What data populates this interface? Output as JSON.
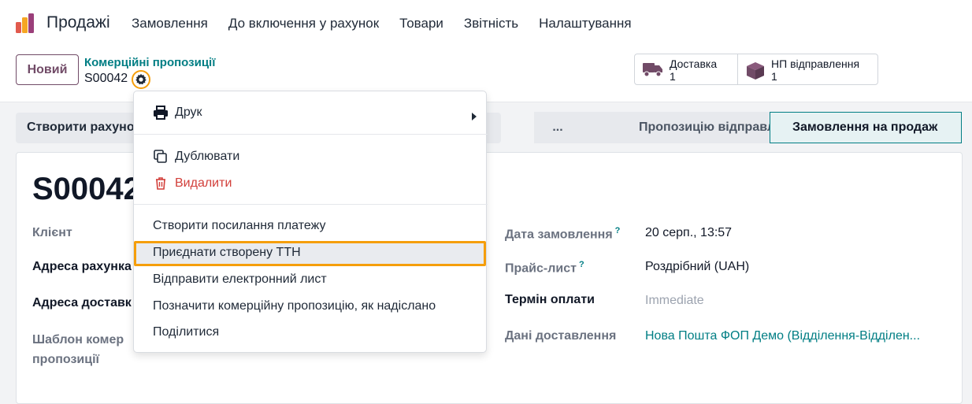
{
  "navbar": {
    "app_name": "Продажі",
    "menu": [
      "Замовлення",
      "До включення у рахунок",
      "Товари",
      "Звітність",
      "Налаштування"
    ]
  },
  "control": {
    "new_button": "Новий",
    "breadcrumb_parent": "Комерційні пропозиції",
    "breadcrumb_current": "S00042",
    "smart_buttons": [
      {
        "label": "Доставка",
        "count": "1",
        "icon": "truck-icon"
      },
      {
        "label": "НП відправлення",
        "count": "1",
        "icon": "box-icon"
      }
    ]
  },
  "actions": {
    "create_invoice": "Створити рахуно"
  },
  "statusbar": {
    "ellipsis": "...",
    "sent": "Пропозицію відправлено",
    "sale_order": "Замовлення на продаж"
  },
  "form": {
    "name": "S00042",
    "left_fields": {
      "client": "Клієнт",
      "invoice_address": "Адреса рахунка",
      "delivery_address": "Адреса доставк",
      "template_line1": "Шаблон комер",
      "template_line2": "пропозиції"
    },
    "right_fields": {
      "order_date_label": "Дата замовлення",
      "order_date_value": "20 серп., 13:57",
      "pricelist_label": "Прайс-лист",
      "pricelist_value": "Роздрібний (UAH)",
      "payment_terms_label": "Термін оплати",
      "payment_terms_value": "Immediate",
      "delivery_data_label": "Дані доставлення",
      "delivery_data_value": "Нова Пошта ФОП Демо (Відділення-Відділен..."
    },
    "help_mark": "?"
  },
  "dropdown": {
    "print": "Друк",
    "duplicate": "Дублювати",
    "delete": "Видалити",
    "payment_link": "Створити посилання платежу",
    "attach_ttn": "Приєднати створену ТТН",
    "send_email": "Відправити електронний лист",
    "mark_sent": "Позначити комерційну пропозицію, як надіслано",
    "share": "Поділитися"
  },
  "colors": {
    "brand": "#714b67",
    "link": "#017e84",
    "highlight": "#f59e0b",
    "danger": "#d23f3a"
  }
}
